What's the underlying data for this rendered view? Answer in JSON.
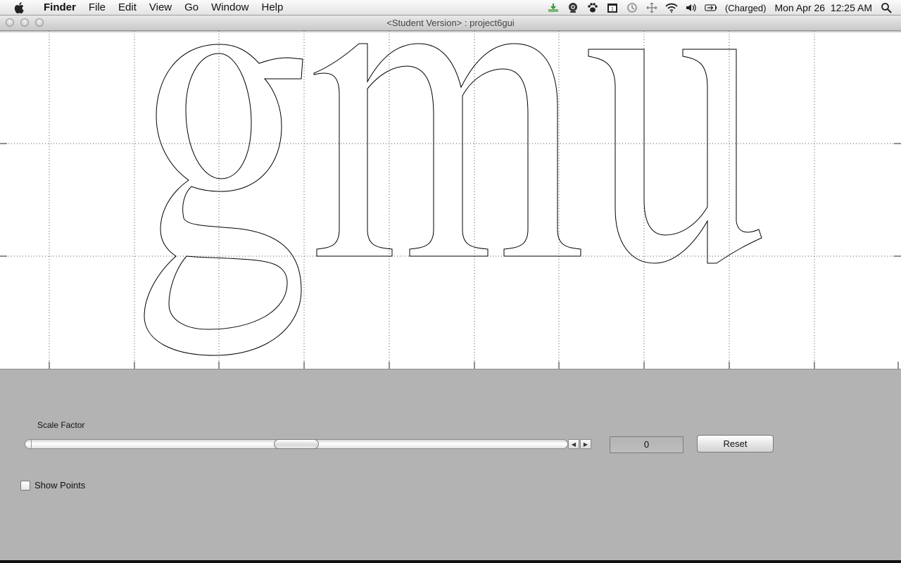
{
  "menubar": {
    "app_name": "Finder",
    "items": [
      "File",
      "Edit",
      "View",
      "Go",
      "Window",
      "Help"
    ],
    "status_icons": [
      "download-icon",
      "webcam-icon",
      "paw-icon",
      "calendar-icon",
      "time-machine-icon",
      "move-icon",
      "wifi-icon",
      "volume-icon",
      "battery-icon"
    ],
    "battery_text": "(Charged)",
    "datetime": "Mon Apr 26  12:25 AM"
  },
  "window": {
    "title": "<Student Version> : project6gui"
  },
  "plot": {
    "glyphs_text": "gmu",
    "grid": true
  },
  "controls": {
    "scale_label": "Scale Factor",
    "slider_value_fraction": 0.5,
    "scale_value": "0",
    "reset_label": "Reset",
    "show_points_label": "Show Points",
    "show_points_checked": false
  }
}
